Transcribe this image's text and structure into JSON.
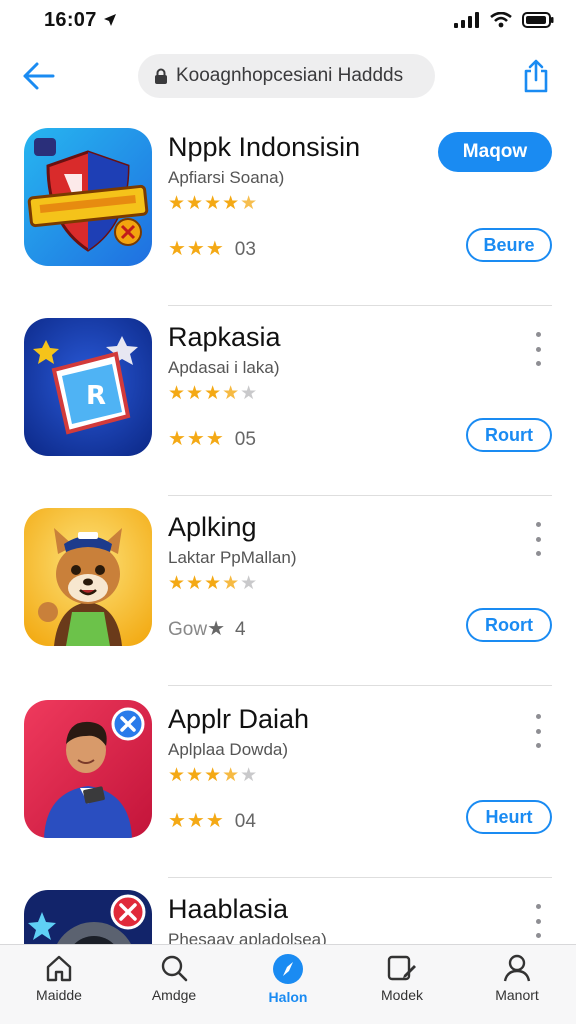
{
  "status": {
    "time": "16:07"
  },
  "search": {
    "text": "Kooagnhopcesiani Haddds"
  },
  "apps": [
    {
      "name": "Nppk Indonsisin",
      "subtitle": "Apfiarsi Soana)",
      "rating": 4.5,
      "meta_text": "03",
      "primary_button": "Maqow",
      "secondary_button": "Beure",
      "icon": "shield-game-icon"
    },
    {
      "name": "Rapkasia",
      "subtitle": "Apdasai i laka)",
      "rating": 3.5,
      "meta_text": "05",
      "secondary_button": "Rourt",
      "icon": "flag-ticket-icon"
    },
    {
      "name": "Aplking",
      "subtitle": "Laktar PpMallan)",
      "rating": 3.5,
      "meta_prefix": "Gow",
      "meta_text": "4",
      "secondary_button": "Roort",
      "icon": "fox-mascot-icon"
    },
    {
      "name": "Applr Daiah",
      "subtitle": "Aplplaa Dowda)",
      "rating": 3.5,
      "meta_text": "04",
      "secondary_button": "Heurt",
      "icon": "businessman-icon"
    },
    {
      "name": "Haablasia",
      "subtitle": "Phesaay apladolsea)",
      "icon": "dark-app-icon"
    }
  ],
  "tabs": [
    {
      "label": "Maidde",
      "icon": "home-icon",
      "active": false
    },
    {
      "label": "Amdge",
      "icon": "search-icon",
      "active": false
    },
    {
      "label": "Halon",
      "icon": "compass-icon",
      "active": true
    },
    {
      "label": "Modek",
      "icon": "edit-icon",
      "active": false
    },
    {
      "label": "Manort",
      "icon": "person-icon",
      "active": false
    }
  ],
  "colors": {
    "accent": "#1a8bf2",
    "star": "#f4a915",
    "star_empty": "#c9c9cb"
  }
}
